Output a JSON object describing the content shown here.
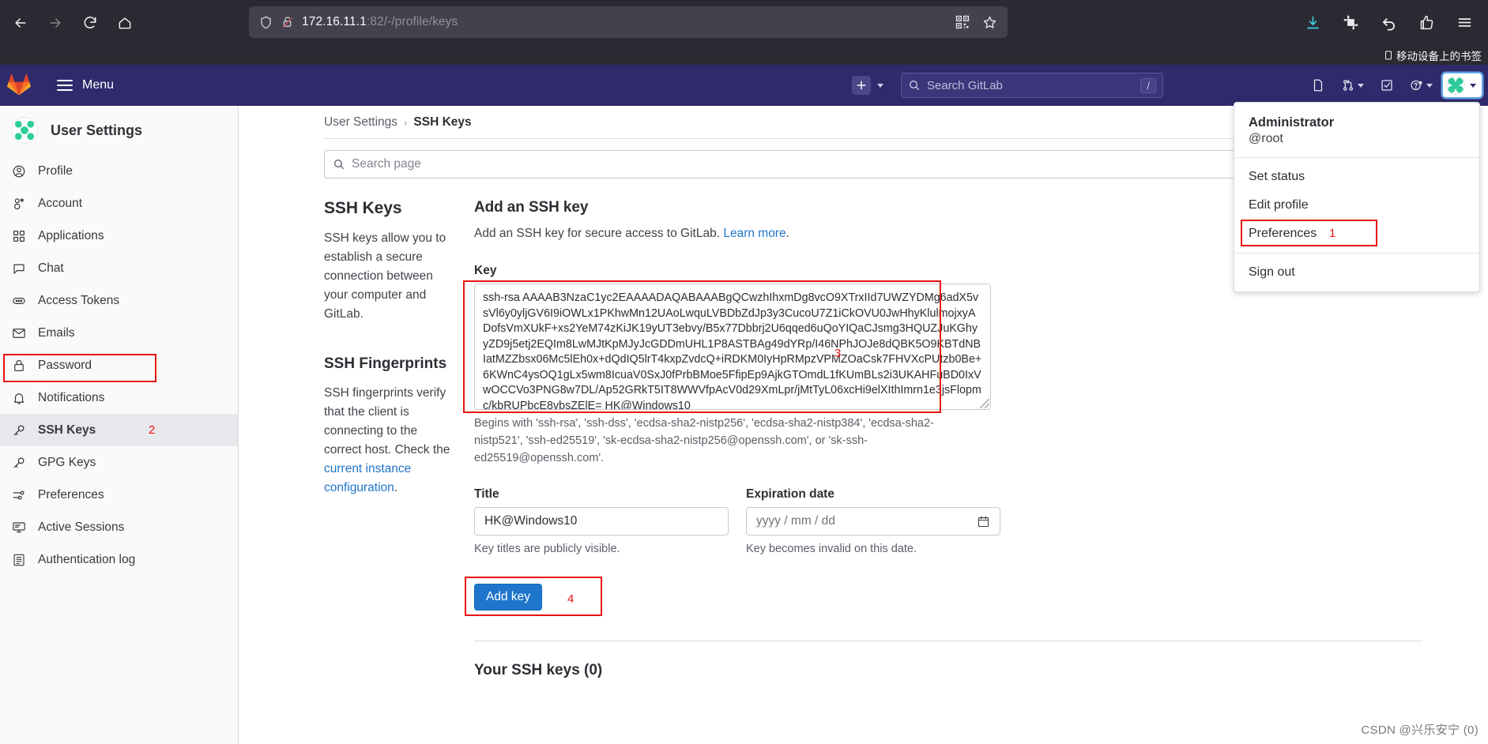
{
  "browser": {
    "url_host": "172.16.11.1",
    "url_rest": ":82/-/profile/keys",
    "back_icon": "back-arrow-icon",
    "forward_icon": "forward-arrow-icon",
    "reload_icon": "reload-icon",
    "home_icon": "home-icon",
    "shield_icon": "shield-icon",
    "lock_broken_icon": "lock-broken-icon",
    "qr_icon": "qr-code-icon",
    "star_icon": "bookmark-star-icon",
    "bookmark_label": "移动设备上的书签"
  },
  "navbar": {
    "menu_label": "Menu",
    "search_placeholder": "Search GitLab",
    "search_shortcut": "/"
  },
  "user_menu": {
    "name": "Administrator",
    "username": "@root",
    "items": [
      {
        "label": "Set status"
      },
      {
        "label": "Edit profile"
      },
      {
        "label": "Preferences",
        "annotation": "1"
      },
      {
        "label": "Sign out"
      }
    ]
  },
  "sidebar": {
    "title": "User Settings",
    "items": [
      {
        "label": "Profile",
        "icon": "user-circle-icon"
      },
      {
        "label": "Account",
        "icon": "account-icon"
      },
      {
        "label": "Applications",
        "icon": "applications-grid-icon"
      },
      {
        "label": "Chat",
        "icon": "chat-bubble-icon"
      },
      {
        "label": "Access Tokens",
        "icon": "token-icon"
      },
      {
        "label": "Emails",
        "icon": "envelope-icon"
      },
      {
        "label": "Password",
        "icon": "lock-icon"
      },
      {
        "label": "Notifications",
        "icon": "bell-icon"
      },
      {
        "label": "SSH Keys",
        "icon": "key-icon",
        "active": true,
        "annotation": "2"
      },
      {
        "label": "GPG Keys",
        "icon": "key-icon"
      },
      {
        "label": "Preferences",
        "icon": "sliders-icon"
      },
      {
        "label": "Active Sessions",
        "icon": "monitor-icon"
      },
      {
        "label": "Authentication log",
        "icon": "list-icon"
      }
    ]
  },
  "breadcrumb": {
    "parent": "User Settings",
    "separator": "›",
    "current": "SSH Keys"
  },
  "page_search": {
    "placeholder": "Search page"
  },
  "left_column": {
    "heading": "SSH Keys",
    "body": "SSH keys allow you to establish a secure connection between your computer and GitLab.",
    "sub_heading": "SSH Fingerprints",
    "sub_body_1": "SSH fingerprints verify that the client is connecting to the correct host. Check the ",
    "sub_link": "current instance configuration",
    "sub_body_2": "."
  },
  "form": {
    "heading": "Add an SSH key",
    "description": "Add an SSH key for secure access to GitLab. ",
    "description_link": "Learn more",
    "description_end": ".",
    "key_label": "Key",
    "key_value": "ssh-rsa AAAAB3NzaC1yc2EAAAADAQABAAABgQCwzhIhxmDg8vcO9XTrxIId7UWZYDMg6adX5vsVl6y0yljGV6I9iOWLx1PKhwMn12UAoLwquLVBDbZdJp3y3CucoU7Z1iCkOVU0JwHhyKlulmojxyADofsVmXUkF+xs2YeM74zKiJK19yUT3ebvy/B5x77Dbbrj2U6qqed6uQoYIQaCJsmg3HQUZJuKGhyyZD9j5etj2EQIm8LwMJtKpMJyJcGDDmUHL1P8ASTBAg49dYRp/I46NPhJOJe8dQBK5O9KBTdNBIatMZZbsx06Mc5lEh0x+dQdIQ5lrT4kxpZvdcQ+iRDKM0IyHpRMpzVPMZOaCsk7FHVXcPUtzb0Be+6KWnC4ysOQ1gLx5wm8IcuaV0SxJ0fPrbBMoe5FfipEp9AjkGTOmdL1fKUmBLs2i3UKAHFuBD0IxVwOCCVo3PNG8w7DL/Ap52GRkT5IT8WWVfpAcV0d29XmLpr/jMtTyL06xcHi9elXIthImrn1e3jsFlopmc/kbRUPbcE8vbsZElE= HK@Windows10",
    "key_annotation": "3",
    "key_helper": "Begins with 'ssh-rsa', 'ssh-dss', 'ecdsa-sha2-nistp256', 'ecdsa-sha2-nistp384', 'ecdsa-sha2-nistp521', 'ssh-ed25519', 'sk-ecdsa-sha2-nistp256@openssh.com', or 'sk-ssh-ed25519@openssh.com'.",
    "title_label": "Title",
    "title_value": "HK@Windows10",
    "title_helper": "Key titles are publicly visible.",
    "expiry_label": "Expiration date",
    "expiry_placeholder": "yyyy / mm / dd",
    "expiry_helper": "Key becomes invalid on this date.",
    "submit_label": "Add key",
    "submit_annotation": "4",
    "your_keys_heading": "Your SSH keys (0)"
  },
  "watermark": "CSDN @兴乐安宁 (0)",
  "colors": {
    "gitlab_navy": "#2f2a6b",
    "link_blue": "#1f75cb",
    "annotation_red": "#e81313",
    "chrome_dark": "#2b2a33"
  }
}
